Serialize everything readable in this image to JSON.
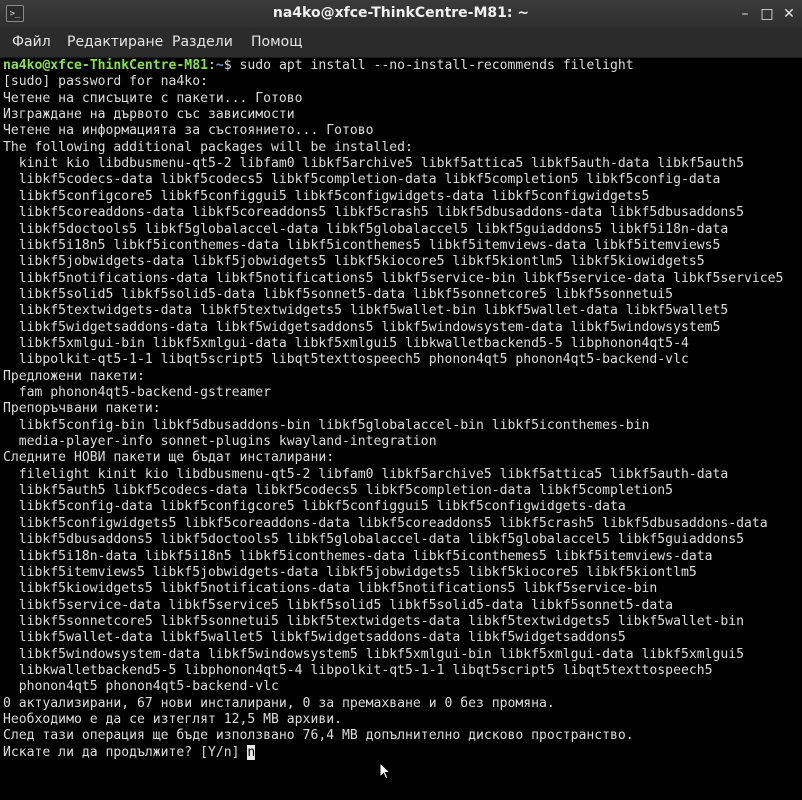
{
  "window": {
    "title": "na4ko@xfce-ThinkCentre-M81: ~",
    "icon_name": "terminal-icon",
    "buttons": {
      "minimize": "–",
      "maximize": "□",
      "close": "✕"
    }
  },
  "menu": [
    "Файл",
    "Редактиране",
    "Раздели",
    "Помощ"
  ],
  "prompt": {
    "user_host": "na4ko@xfce-ThinkCentre-M81",
    "separator": ":",
    "path": "~",
    "symbol": "$",
    "command": " sudo apt install --no-install-recommends filelight"
  },
  "output": [
    "[sudo] password for na4ko:",
    "Четене на списъците с пакети... Готово",
    "Изграждане на дървото със зависимости",
    "Четене на информацията за състоянието... Готово",
    "The following additional packages will be installed:",
    "  kinit kio libdbusmenu-qt5-2 libfam0 libkf5archive5 libkf5attica5 libkf5auth-data libkf5auth5",
    "  libkf5codecs-data libkf5codecs5 libkf5completion-data libkf5completion5 libkf5config-data",
    "  libkf5configcore5 libkf5configgui5 libkf5configwidgets-data libkf5configwidgets5",
    "  libkf5coreaddons-data libkf5coreaddons5 libkf5crash5 libkf5dbusaddons-data libkf5dbusaddons5",
    "  libkf5doctools5 libkf5globalaccel-data libkf5globalaccel5 libkf5guiaddons5 libkf5i18n-data",
    "  libkf5i18n5 libkf5iconthemes-data libkf5iconthemes5 libkf5itemviews-data libkf5itemviews5",
    "  libkf5jobwidgets-data libkf5jobwidgets5 libkf5kiocore5 libkf5kiontlm5 libkf5kiowidgets5",
    "  libkf5notifications-data libkf5notifications5 libkf5service-bin libkf5service-data libkf5service5",
    "  libkf5solid5 libkf5solid5-data libkf5sonnet5-data libkf5sonnetcore5 libkf5sonnetui5",
    "  libkf5textwidgets-data libkf5textwidgets5 libkf5wallet-bin libkf5wallet-data libkf5wallet5",
    "  libkf5widgetsaddons-data libkf5widgetsaddons5 libkf5windowsystem-data libkf5windowsystem5",
    "  libkf5xmlgui-bin libkf5xmlgui-data libkf5xmlgui5 libkwalletbackend5-5 libphonon4qt5-4",
    "  libpolkit-qt5-1-1 libqt5script5 libqt5texttospeech5 phonon4qt5 phonon4qt5-backend-vlc",
    "Предложени пакети:",
    "  fam phonon4qt5-backend-gstreamer",
    "Препоръчвани пакети:",
    "  libkf5config-bin libkf5dbusaddons-bin libkf5globalaccel-bin libkf5iconthemes-bin",
    "  media-player-info sonnet-plugins kwayland-integration",
    "Следните НОВИ пакети ще бъдат инсталирани:",
    "  filelight kinit kio libdbusmenu-qt5-2 libfam0 libkf5archive5 libkf5attica5 libkf5auth-data",
    "  libkf5auth5 libkf5codecs-data libkf5codecs5 libkf5completion-data libkf5completion5",
    "  libkf5config-data libkf5configcore5 libkf5configgui5 libkf5configwidgets-data",
    "  libkf5configwidgets5 libkf5coreaddons-data libkf5coreaddons5 libkf5crash5 libkf5dbusaddons-data",
    "  libkf5dbusaddons5 libkf5doctools5 libkf5globalaccel-data libkf5globalaccel5 libkf5guiaddons5",
    "  libkf5i18n-data libkf5i18n5 libkf5iconthemes-data libkf5iconthemes5 libkf5itemviews-data",
    "  libkf5itemviews5 libkf5jobwidgets-data libkf5jobwidgets5 libkf5kiocore5 libkf5kiontlm5",
    "  libkf5kiowidgets5 libkf5notifications-data libkf5notifications5 libkf5service-bin",
    "  libkf5service-data libkf5service5 libkf5solid5 libkf5solid5-data libkf5sonnet5-data",
    "  libkf5sonnetcore5 libkf5sonnetui5 libkf5textwidgets-data libkf5textwidgets5 libkf5wallet-bin",
    "  libkf5wallet-data libkf5wallet5 libkf5widgetsaddons-data libkf5widgetsaddons5",
    "  libkf5windowsystem-data libkf5windowsystem5 libkf5xmlgui-bin libkf5xmlgui-data libkf5xmlgui5",
    "  libkwalletbackend5-5 libphonon4qt5-4 libpolkit-qt5-1-1 libqt5script5 libqt5texttospeech5",
    "  phonon4qt5 phonon4qt5-backend-vlc",
    "0 актуализирани, 67 нови инсталирани, 0 за премахване и 0 без промяна.",
    "Необходимо е да се изтеглят 12,5 MB архиви.",
    "След тази операция ще бъде използвано 76,4 MB допълнително дисково пространство.",
    "Искате ли да продължите? [Y/n] n"
  ],
  "colors": {
    "user_host": "#86e04a",
    "path": "#6c9bd2",
    "text": "#dcdcdc",
    "background": "#000000"
  }
}
